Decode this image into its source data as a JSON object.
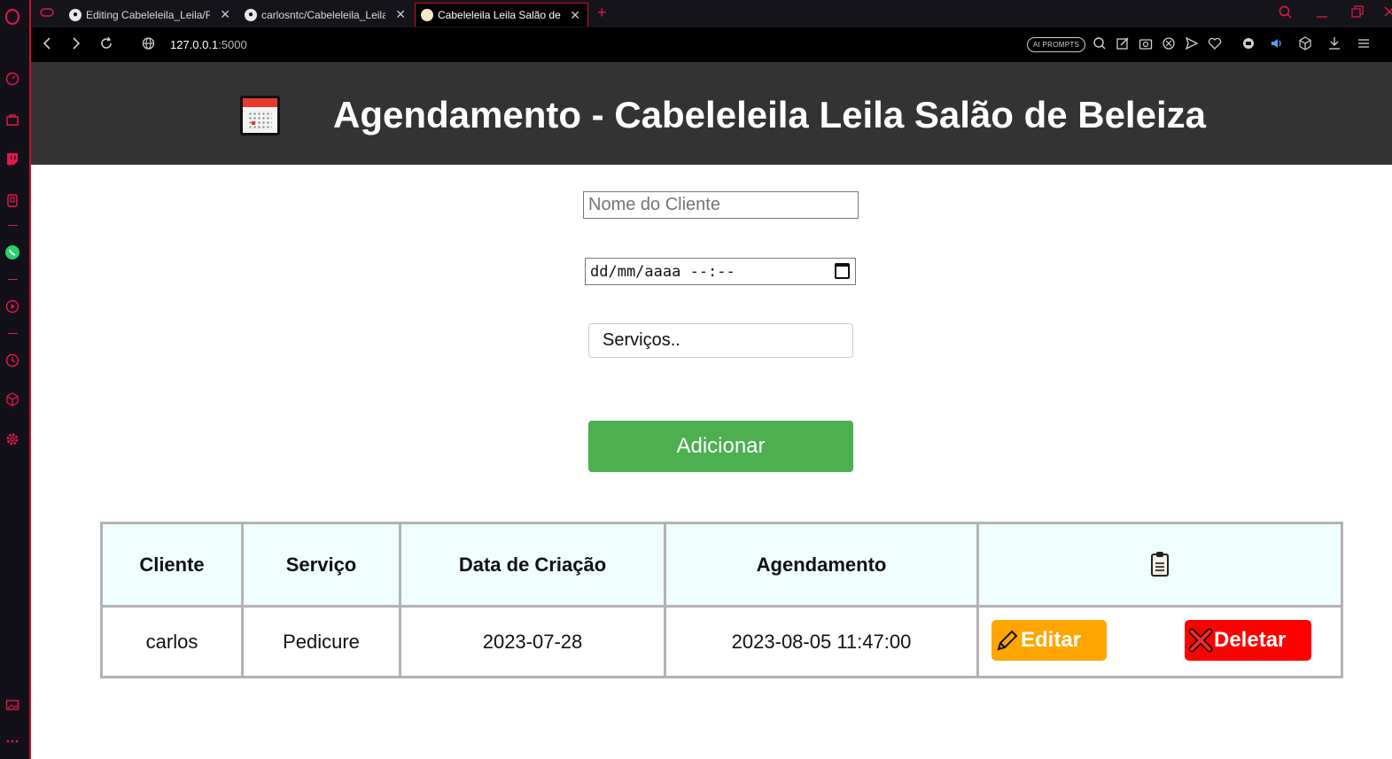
{
  "browser": {
    "tabs": [
      {
        "title": "Editing Cabeleleila_Leila/RE",
        "close": "✕"
      },
      {
        "title": "carlosntc/Cabeleleila_Leila",
        "close": "✕"
      },
      {
        "title": "Cabeleleila Leila Salão de B",
        "close": "✕"
      }
    ],
    "new_tab": "+",
    "url_host": "127.0.0.1",
    "url_port": ":5000",
    "ai_prompts_label": "AI PROMPTS"
  },
  "header": {
    "title": "Agendamento - Cabeleleila Leila Salão de Beleiza"
  },
  "form": {
    "client_placeholder": "Nome do Cliente",
    "datetime_placeholder": "dd/mm/aaaa --:--",
    "services_placeholder": "Serviços..",
    "add_label": "Adicionar"
  },
  "table": {
    "headers": [
      "Cliente",
      "Serviço",
      "Data de Criação",
      "Agendamento"
    ],
    "actions_header_icon": "clipboard-icon",
    "rows": [
      {
        "cliente": "carlos",
        "servico": "Pedicure",
        "criacao": "2023-07-28",
        "agendamento": "2023-08-05 11:47:00"
      }
    ],
    "edit_label": "Editar",
    "delete_label": "Deletar"
  },
  "colors": {
    "header_bg": "#333333",
    "add_button": "#4caf50",
    "edit_button": "#ffa500",
    "delete_button": "#ff0000",
    "table_header_bg": "#effdfd",
    "browser_accent": "#c8102e"
  }
}
